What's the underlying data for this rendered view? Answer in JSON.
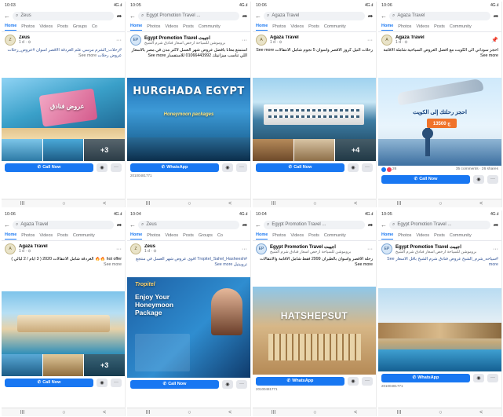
{
  "colors": {
    "fb_blue": "#1877f2",
    "whatsapp_green": "#25d366"
  },
  "phones": [
    {
      "time": "10:03",
      "signal": "4G .ıl",
      "search": "Zeus",
      "tabs": [
        "Home",
        "Photos",
        "Videos",
        "Posts",
        "Groups",
        "Co"
      ],
      "page_name": "Zeus",
      "time_ago": "1 d · ⊙",
      "caption": "#رحلات_الشرم مرسي علم الغردقة الاقصر اسوان #عروض_رحلات عروض رحلات",
      "see_more": "See more",
      "banner": "عروض فنادق",
      "plus": "+3",
      "button": "Call Now",
      "bottom_ts": ""
    },
    {
      "time": "10:05",
      "signal": "4G .ıl",
      "search": "Egypt Promotion Travel ...",
      "tabs": [
        "Home",
        "Photos",
        "Videos",
        "Posts",
        "Community"
      ],
      "page_name": "Egypt Promotion Travel اجيبت",
      "time_ago": "1 d · ⊙",
      "subtitle": "بروموشن للسياحة ارخص اسعار فنادق شرم الشيخ",
      "caption": "استمتع معانا بافضل عروض شهر العسل لاكتر مدن في مصر بالاسعار اللي تناسب ميزانيتك 01066443992 للاستفسار See more",
      "see_more": "See more",
      "banner": "HURGHADA EGYPT",
      "banner_sub": "Honeymoon packages",
      "button": "WhatsApp",
      "bottom_ts": "20100481771"
    },
    {
      "time": "10:06",
      "signal": "4G .ıl",
      "search": "Agaza Travel",
      "tabs": [
        "Home",
        "Photos",
        "Videos",
        "Posts",
        "Community"
      ],
      "page_name": "Agaza Travel",
      "time_ago": "1 d · ⊙",
      "caption": "رحلات النيل كروز الاقصر واسوان 5 نجوم شامل الانتقالات See more",
      "see_more": "See more",
      "plus": "+4",
      "button": "Call Now",
      "bottom_ts": ""
    },
    {
      "time": "10:06",
      "signal": "4G .ıl",
      "search": "Agaza Travel",
      "tabs": [
        "Home",
        "Photos",
        "Videos",
        "Posts",
        "Community"
      ],
      "page_name": "Agaza Travel",
      "time_ago": "1 d · ⊙",
      "caption": "احجز سوداني الى الكويت مع افضل العروض السياحية شاملة الاقامة See more",
      "see_more": "See more",
      "banner": "احجز رحلتك إلى الكويت",
      "banner_sub": "13500 ج",
      "reactions": "26",
      "reactions_right": "35 comments · 26 shares",
      "button": "Call Now",
      "bottom_ts": ""
    },
    {
      "time": "10:06",
      "signal": "4G .ıl",
      "search": "Agaza Travel",
      "tabs": [
        "Home",
        "Photos",
        "Videos",
        "Posts",
        "Community"
      ],
      "page_name": "Agaza Travel",
      "time_ago": "1 d · ⊙",
      "caption": "hot offer 🔥🔥 الغردقة شامل الانتقالات 2020 ( 3 ايام / 2 ليالي )",
      "see_more": "See more",
      "plus": "+3",
      "button": "Call Now",
      "bottom_ts": ""
    },
    {
      "time": "10:04",
      "signal": "4G .ıl",
      "search": "Zeus",
      "tabs": [
        "Home",
        "Photos",
        "Videos",
        "Posts",
        "Groups",
        "Co"
      ],
      "page_name": "Zeus",
      "time_ago": "1 d · ⊙",
      "caption": "#Tropitel_Sahel_Hasheesh اقوى عروض شهر العسل في منتجع تروبيتيل See more",
      "see_more": "See more",
      "banner": "Enjoy Your Honeymoon Package",
      "banner_sub": "Tropitel",
      "button": "Call Now",
      "bottom_ts": ""
    },
    {
      "time": "10:04",
      "signal": "4G .ıl",
      "search": "Egypt Promotion Travel ...",
      "tabs": [
        "Home",
        "Photos",
        "Videos",
        "Posts",
        "Community"
      ],
      "page_name": "Egypt Promotion Travel اجيبت",
      "time_ago": "1 d · ⊙",
      "subtitle": "بروموشن للسياحة ارخص اسعار فنادق شرم الشيخ",
      "caption": "رحلة الاقصر واسوان بالطيران 2999 فقط شامل الاقامة والانتقالات See more",
      "see_more": "See more",
      "banner": "HATSHEPSUT",
      "button": "WhatsApp",
      "bottom_ts": "20100481771"
    },
    {
      "time": "10:05",
      "signal": "4G .ıl",
      "search": "Egypt Promotion Travel ...",
      "tabs": [
        "Home",
        "Photos",
        "Videos",
        "Posts",
        "Community"
      ],
      "page_name": "Egypt Promotion Travel اجيبت",
      "time_ago": "1 d · ⊙",
      "subtitle": "بروموشن للسياحة ارخص اسعار فنادق شرم الشيخ",
      "caption": "#سياحه_شرم_الشيخ عروض فنادق شرم الشيخ بأقل الاسعار See more",
      "see_more": "See more",
      "button": "WhatsApp",
      "bottom_ts": "20100481771"
    }
  ],
  "nav": {
    "recent": "III",
    "home": "○",
    "back": "<"
  }
}
